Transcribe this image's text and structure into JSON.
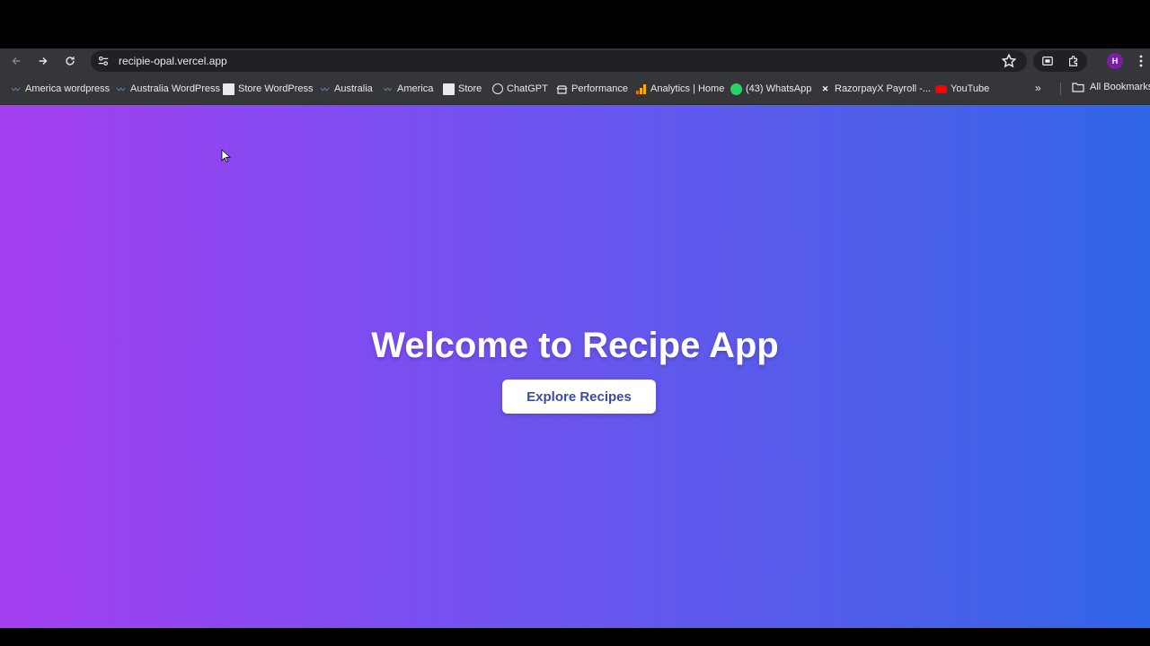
{
  "browser": {
    "url": "recipie-opal.vercel.app",
    "avatar_initial": "H"
  },
  "bookmarks": [
    {
      "label": "America wordpress",
      "icon": "wordpress-icon"
    },
    {
      "label": "Australia WordPress",
      "icon": "wordpress-icon"
    },
    {
      "label": "Store WordPress",
      "icon": "store-icon"
    },
    {
      "label": "Australia",
      "icon": "wordpress-icon"
    },
    {
      "label": "America",
      "icon": "wordpress-icon"
    },
    {
      "label": "Store",
      "icon": "store-icon"
    },
    {
      "label": "ChatGPT",
      "icon": "chatgpt-icon"
    },
    {
      "label": "Performance",
      "icon": "performance-icon"
    },
    {
      "label": "Analytics | Home",
      "icon": "analytics-icon"
    },
    {
      "label": "(43) WhatsApp",
      "icon": "whatsapp-icon"
    },
    {
      "label": "RazorpayX Payroll -...",
      "icon": "razorpay-icon"
    },
    {
      "label": "YouTube",
      "icon": "youtube-icon"
    }
  ],
  "all_bookmarks_label": "All Bookmarks",
  "hero": {
    "title": "Welcome to Recipe App",
    "button_label": "Explore Recipes"
  },
  "colors": {
    "gradient_start": "#a53ff0",
    "gradient_end": "#2f66e8",
    "button_text": "#3b4aa8"
  }
}
